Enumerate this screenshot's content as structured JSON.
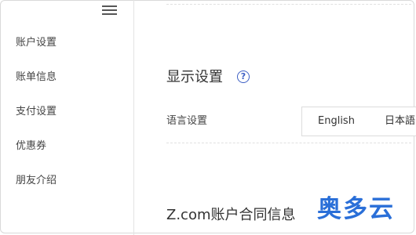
{
  "sidebar": {
    "menu_icon": "hamburger-menu-icon",
    "items": [
      {
        "label": "账户设置"
      },
      {
        "label": "账单信息"
      },
      {
        "label": "支付设置"
      },
      {
        "label": "优惠券"
      },
      {
        "label": "朋友介绍"
      }
    ]
  },
  "display_settings": {
    "title": "显示设置",
    "help_icon": "question-circle-icon",
    "help_glyph": "?",
    "language_label": "语言设置",
    "languages": [
      "English",
      "日本語"
    ]
  },
  "contract": {
    "title": "Z.com账户合同信息"
  },
  "watermark": {
    "text": "奥多云",
    "color": "#2a6fd8"
  },
  "colors": {
    "accent": "#3d5fc4"
  }
}
